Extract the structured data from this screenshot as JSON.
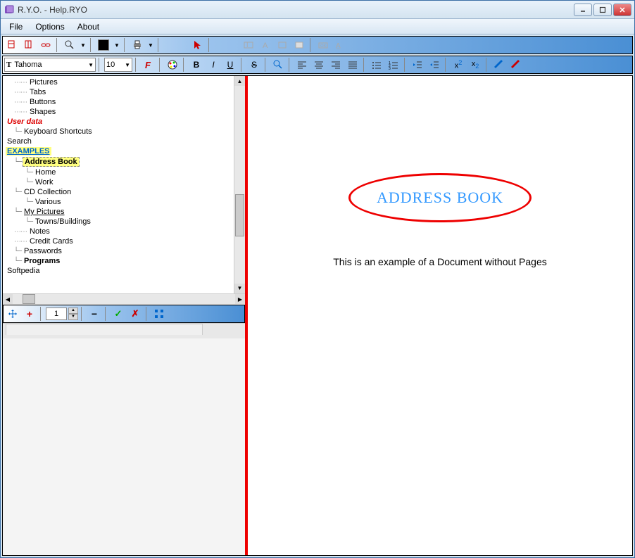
{
  "window": {
    "title": "R.Y.O. - Help.RYO"
  },
  "menubar": {
    "file": "File",
    "options": "Options",
    "about": "About"
  },
  "format": {
    "font": "Tahoma",
    "size": "10"
  },
  "tree": {
    "items": [
      {
        "label": "Pictures",
        "indent": 1,
        "dots": true
      },
      {
        "label": "Tabs",
        "indent": 1,
        "dots": true
      },
      {
        "label": "Buttons",
        "indent": 1,
        "dots": true
      },
      {
        "label": "Shapes",
        "indent": 1,
        "dots": true
      },
      {
        "label": "User data",
        "indent": 0,
        "cls": "red-italic"
      },
      {
        "label": "Keyboard Shortcuts",
        "indent": 1,
        "line": true
      },
      {
        "label": "Search",
        "indent": 0
      },
      {
        "label": "EXAMPLES",
        "indent": 0,
        "cls": "blue-underline"
      },
      {
        "label": "Address Book",
        "indent": 1,
        "line": true,
        "cls": "bold selected"
      },
      {
        "label": "Home",
        "indent": 2,
        "line": true
      },
      {
        "label": "Work",
        "indent": 2,
        "line": true
      },
      {
        "label": "CD Collection",
        "indent": 1,
        "line": true
      },
      {
        "label": "Various",
        "indent": 2,
        "line": true
      },
      {
        "label": "My Pictures",
        "indent": 1,
        "line": true,
        "cls": "underline"
      },
      {
        "label": "Towns/Buildings",
        "indent": 2,
        "line": true
      },
      {
        "label": "Notes",
        "indent": 1,
        "dots": true
      },
      {
        "label": "Credit Cards",
        "indent": 1,
        "dots": true
      },
      {
        "label": "Passwords",
        "indent": 1,
        "line": true
      },
      {
        "label": "Programs",
        "indent": 1,
        "line": true,
        "cls": "bold"
      },
      {
        "label": "Softpedia",
        "indent": 0
      }
    ]
  },
  "bottom": {
    "page_num": "1"
  },
  "doc": {
    "title": "ADDRESS BOOK",
    "subtitle": "This is an example of a Document without Pages"
  }
}
